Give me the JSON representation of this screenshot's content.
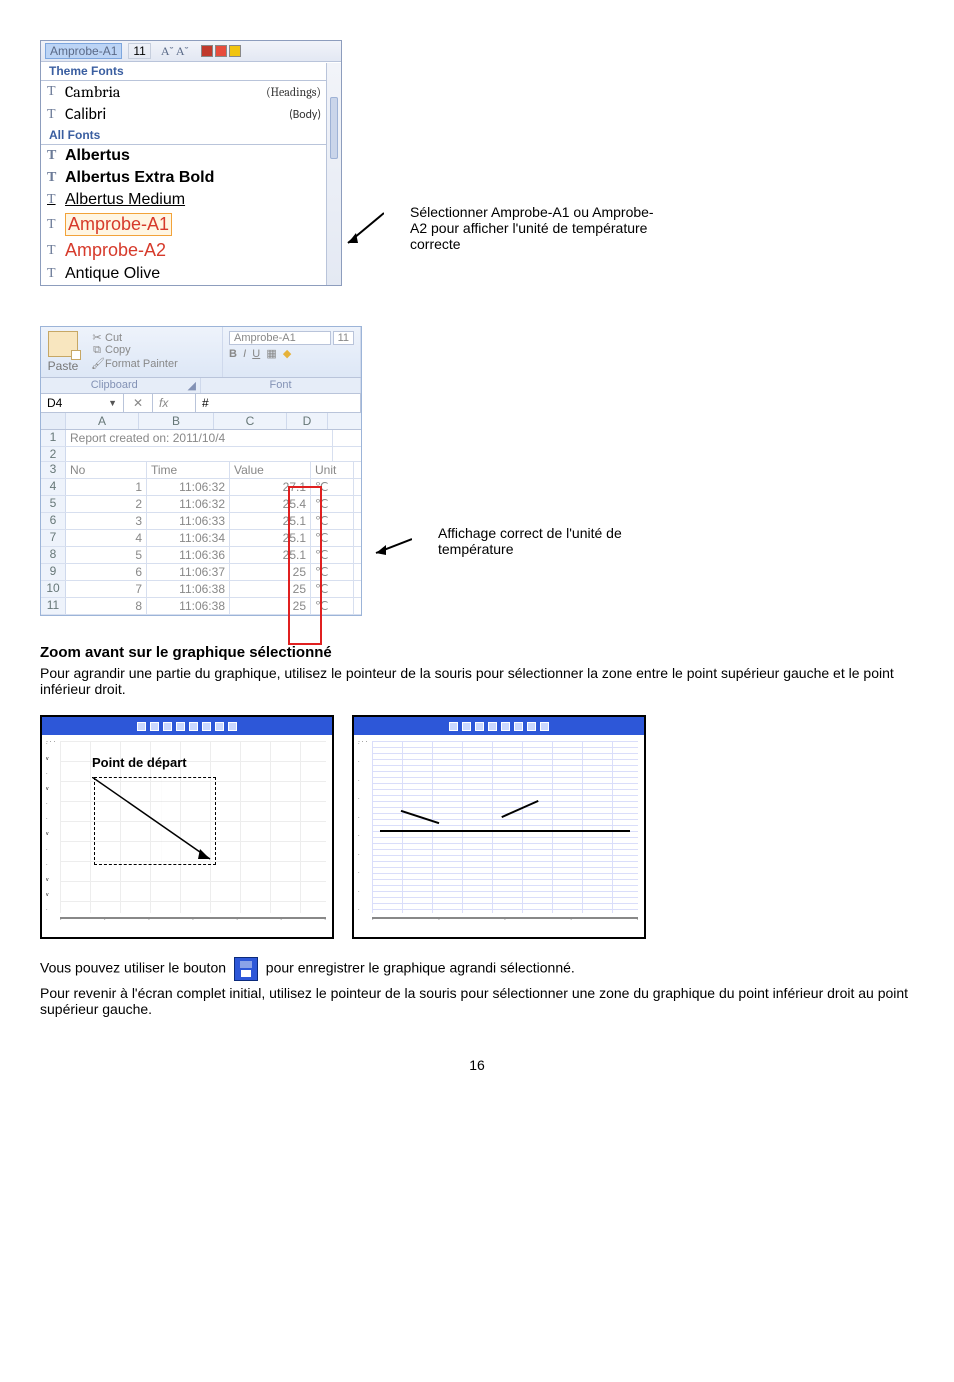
{
  "fontDropdown": {
    "selected": "Amprobe-A1",
    "size": "11",
    "aa": "A˘  A˘",
    "sections": {
      "theme": "Theme Fonts",
      "all": "All Fonts"
    },
    "items": {
      "cambria": "Cambria",
      "cambriaHint": "(Headings)",
      "calibri": "Calibri",
      "calibriHint": "(Body)",
      "albertus": "Albertus",
      "albertusXB": "Albertus Extra Bold",
      "albertusMd": "Albertus Medium",
      "amprobeA1": "Amprobe-A1",
      "amprobeA2": "Amprobe-A2",
      "antique": "Antique Olive"
    }
  },
  "callouts": {
    "selectFont": "Sélectionner Amprobe-A1 ou Amprobe-A2 pour afficher l'unité de température correcte",
    "unitDisplay": "Affichage correct de l'unité de température"
  },
  "excel": {
    "ribbon": {
      "paste": "Paste",
      "cut": "Cut",
      "copy": "Copy",
      "formatPainter": "Format Painter",
      "fontName": "Amprobe-A1",
      "fontSize": "11",
      "b": "B",
      "i": "I",
      "u": "U",
      "groupClipboard": "Clipboard",
      "groupFont": "Font"
    },
    "nameBox": "D4",
    "fx": "fx",
    "fxVal": "#",
    "colHeads": {
      "a": "A",
      "b": "B",
      "c": "C",
      "d": "D"
    },
    "rowHeads": [
      "1",
      "2",
      "3",
      "4",
      "5",
      "6",
      "7",
      "8",
      "9",
      "10",
      "11"
    ],
    "r1": "Report created on: 2011/10/4",
    "headers": {
      "no": "No",
      "time": "Time",
      "value": "Value",
      "unit": "Unit"
    },
    "rows": [
      {
        "no": "1",
        "time": "11:06:32",
        "value": "27.1",
        "unit": "℃"
      },
      {
        "no": "2",
        "time": "11:06:32",
        "value": "25.4",
        "unit": "℃"
      },
      {
        "no": "3",
        "time": "11:06:33",
        "value": "25.1",
        "unit": "℃"
      },
      {
        "no": "4",
        "time": "11:06:34",
        "value": "25.1",
        "unit": "℃"
      },
      {
        "no": "5",
        "time": "11:06:36",
        "value": "25.1",
        "unit": "℃"
      },
      {
        "no": "6",
        "time": "11:06:37",
        "value": "25",
        "unit": "℃"
      },
      {
        "no": "7",
        "time": "11:06:38",
        "value": "25",
        "unit": "℃"
      },
      {
        "no": "8",
        "time": "11:06:38",
        "value": "25",
        "unit": "℃"
      }
    ]
  },
  "zoom": {
    "title": "Zoom avant sur le graphique sélectionné",
    "para1": "Pour agrandir une partie du graphique, utilisez le pointeur de la souris pour sélectionner la zone entre le point supérieur gauche et le point inférieur droit.",
    "startLabel": "Point de départ",
    "para2a": "Vous pouvez utiliser le bouton ",
    "para2b": " pour enregistrer le graphique agrandi sélectionné.",
    "para3": "Pour revenir à l'écran complet initial, utilisez le pointeur de la souris pour sélectionner une zone du graphique du point inférieur droit au point supérieur gauche."
  },
  "pageNumber": "16"
}
